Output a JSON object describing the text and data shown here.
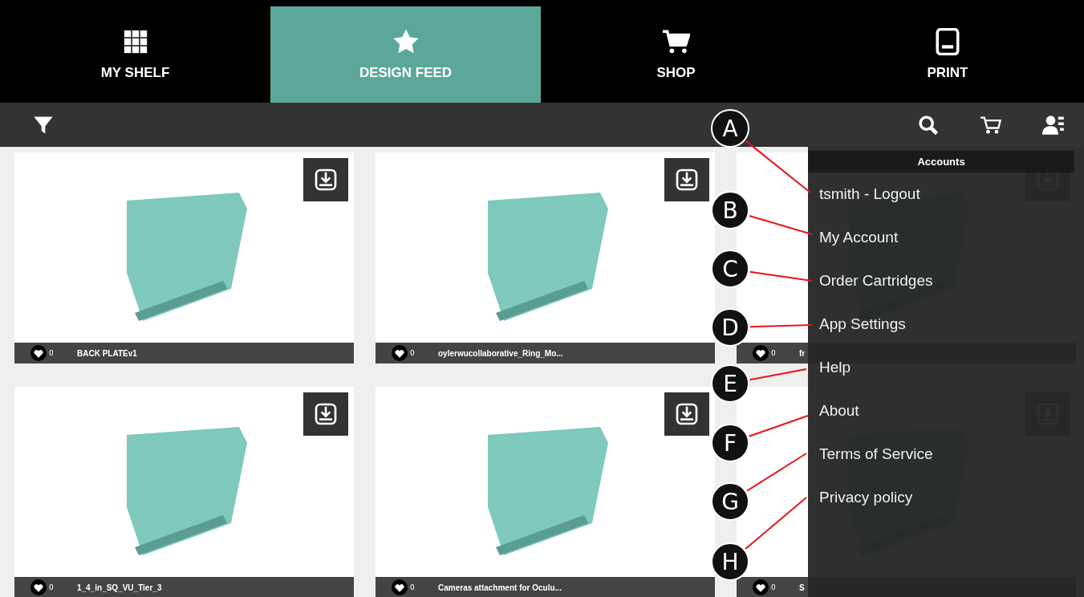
{
  "nav_tabs": [
    {
      "label": "MY SHELF",
      "kind": "grid",
      "selected": false
    },
    {
      "label": "DESIGN FEED",
      "kind": "star",
      "selected": true
    },
    {
      "label": "SHOP",
      "kind": "cart",
      "selected": false
    },
    {
      "label": "PRINT",
      "kind": "tablet",
      "selected": false
    }
  ],
  "designs": [
    {
      "title": "BACK PLATEv1",
      "likes": "0"
    },
    {
      "title": "oylerwucollaborative_Ring_Mo...",
      "likes": "0"
    },
    {
      "title": "fr",
      "likes": "0"
    },
    {
      "title": "1_4_in_SQ_VU_Tier_3",
      "likes": "0"
    },
    {
      "title": "Cameras attachment for Oculu...",
      "likes": "0"
    },
    {
      "title": "S",
      "likes": "0"
    }
  ],
  "accounts_menu": {
    "title": "Accounts",
    "items": [
      "tsmith - Logout",
      "My Account",
      "Order Cartridges",
      "App Settings",
      "Help",
      "About",
      "Terms of Service",
      "Privacy policy"
    ]
  },
  "callouts": [
    "A",
    "B",
    "C",
    "D",
    "E",
    "F",
    "G",
    "H"
  ]
}
